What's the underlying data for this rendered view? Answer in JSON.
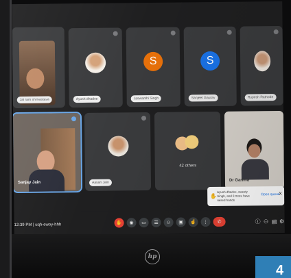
{
  "meeting": {
    "time": "12:39 PM",
    "code": "uqh-ewoy-hhh"
  },
  "tiles": [
    {
      "name": "Jai ram shrivastava"
    },
    {
      "name": "Ayush dhadve"
    },
    {
      "name": "Jaswanthi Singh",
      "letter": "S",
      "color": "#e8710a"
    },
    {
      "name": "Sanjeet Gaurav",
      "letter": "S",
      "color": "#1a73e8"
    },
    {
      "name": "Rupesh Rathode"
    },
    {
      "name": "Sanjay Jain"
    },
    {
      "name": "Aayan Jain"
    },
    {
      "name": "42 others"
    },
    {
      "name": "Dr Garima"
    }
  ],
  "notification": {
    "text": "Ayush dhadve, swesty Singh, and 8 more have raised hands",
    "action": "Open queue",
    "close": "X"
  },
  "controls": [
    "hand-raise-icon",
    "mic-icon",
    "camera-icon",
    "captions-icon",
    "emoji-icon",
    "present-icon",
    "raise-hand-icon",
    "more-icon",
    "end-call-icon"
  ],
  "corner_number": "4",
  "brand": "hp"
}
